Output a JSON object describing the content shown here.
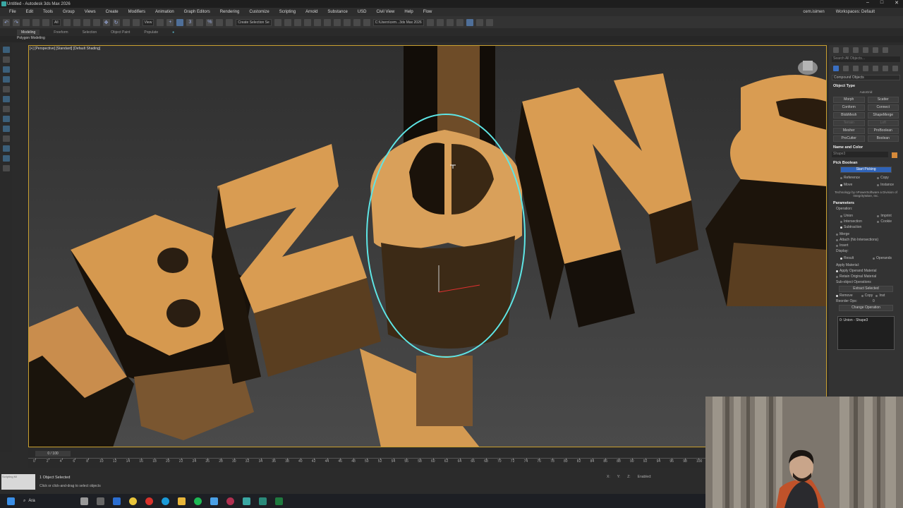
{
  "window": {
    "title": "Untitled - Autodesk 3ds Max 2026"
  },
  "menu": {
    "items": [
      "File",
      "Edit",
      "Tools",
      "Group",
      "Views",
      "Create",
      "Modifiers",
      "Animation",
      "Graph Editors",
      "Rendering",
      "Customize",
      "Scripting",
      "Arnold",
      "Substance",
      "USD",
      "Civil View",
      "Help",
      "Flow"
    ],
    "user": "cem.isimen",
    "workspace_label": "Workspaces:",
    "workspace_value": "Default"
  },
  "toolbar": {
    "filter_value": "All",
    "view_value": "View",
    "selection_set_placeholder": "Create Selection Se",
    "project_path": "C:\\Users\\cem...3ds Max 2026"
  },
  "ribbon": {
    "tabs": [
      "Modeling",
      "Freeform",
      "Selection",
      "Object Paint",
      "Populate"
    ],
    "sub_label": "Polygon Modeling"
  },
  "viewport": {
    "label": "[+] [Perspective] [Standard] [Default Shading]",
    "letters": [
      "B",
      "Z",
      "U",
      "N",
      "S"
    ]
  },
  "command_panel": {
    "search_placeholder": "Search All Objects...",
    "category": "Compound Objects",
    "object_type": {
      "title": "Object Type",
      "autogrid": "AutoGrid",
      "buttons": [
        "Morph",
        "Scatter",
        "Conform",
        "Connect",
        "BlobMesh",
        "ShapeMerge",
        "Terrain",
        "Loft",
        "Mesher",
        "ProBoolean",
        "ProCutter",
        "Boolean"
      ]
    },
    "name_color": {
      "title": "Name and Color",
      "name": "Shape3",
      "color": "#d68a3a"
    },
    "pick_boolean": {
      "title": "Pick Boolean",
      "start_button": "Start Picking",
      "options": [
        "Reference",
        "Copy",
        "Move",
        "Instance"
      ],
      "credits": "Technology by nPowerSoftware a Division of IntegrityWare, Inc."
    },
    "parameters": {
      "title": "Parameters",
      "operation_label": "Operation:",
      "operations": [
        "Union",
        "Imprint",
        "Intersection",
        "Cookie",
        "Subtraction",
        "Merge",
        "Attach (No Intersections)",
        "Insert"
      ],
      "display_label": "Display:",
      "display_options": [
        "Result",
        "Operands"
      ],
      "apply_material_label": "Apply Material:",
      "apply_material_options": [
        "Apply Operand Material",
        "Retain Original Material"
      ],
      "subobject_label": "Sub-object Operations",
      "extract_button": "Extract Selected",
      "extract_options": [
        "Remove",
        "Copy",
        "Inst"
      ],
      "reorder_label": "Reorder Ops:",
      "reorder_value": "0",
      "change_button": "Change Operation",
      "list_item": "0: Union - Shape3"
    }
  },
  "timeline": {
    "frame_display": "0 / 100",
    "ticks": [
      "0",
      "2",
      "4",
      "6",
      "8",
      "10",
      "12",
      "14",
      "16",
      "18",
      "20",
      "22",
      "24",
      "26",
      "28",
      "30",
      "32",
      "34",
      "36",
      "38",
      "40",
      "42",
      "44",
      "46",
      "48",
      "50",
      "52",
      "54",
      "56",
      "58",
      "60",
      "62",
      "64",
      "66",
      "68",
      "70",
      "72",
      "74",
      "76",
      "78",
      "80",
      "82",
      "84",
      "86",
      "88",
      "90",
      "92",
      "94",
      "96",
      "98",
      "100"
    ]
  },
  "status": {
    "selection": "1 Object Selected",
    "prompt": "Click or click-and-drag to select objects",
    "script_label": "Scripting Mi",
    "x_label": "X:",
    "y_label": "Y:",
    "z_label": "Z:",
    "enabled_label": "Enabled:"
  },
  "taskbar": {
    "search_label": "Ara"
  }
}
